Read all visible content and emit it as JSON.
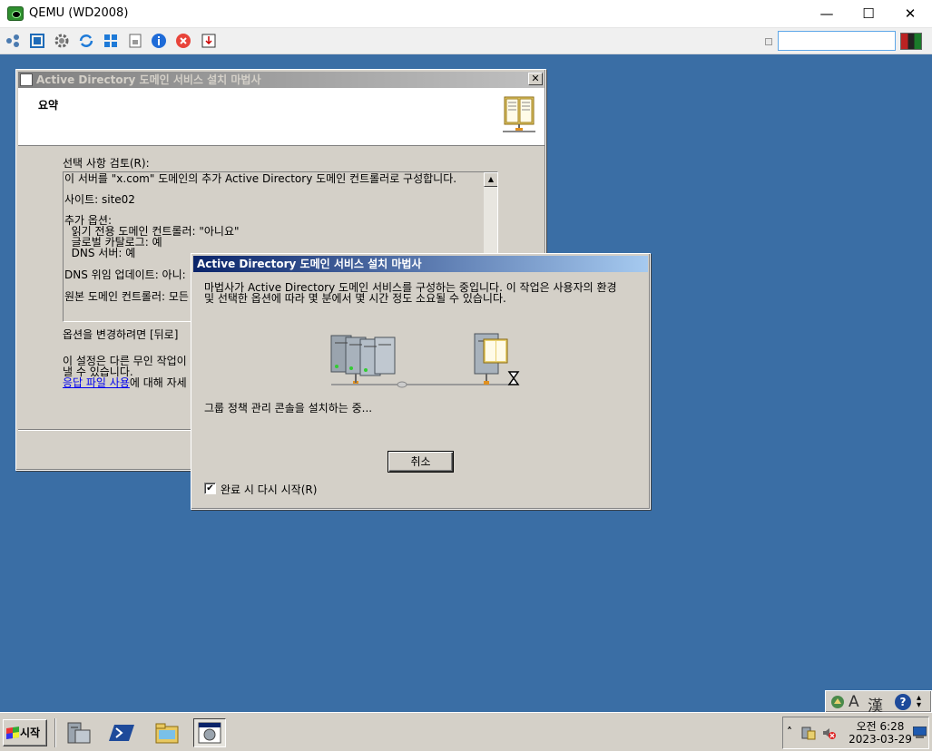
{
  "host": {
    "title": "QEMU (WD2008)",
    "minimize": "—",
    "maximize": "☐",
    "close": "✕",
    "toolbar_icons": [
      "network-icon",
      "fullscreen-icon",
      "settings-icon",
      "refresh-icon",
      "windows-logo-icon",
      "document-icon",
      "info-icon",
      "stop-icon",
      "exit-icon"
    ]
  },
  "bg_wizard": {
    "title": "Active Directory 도메인 서비스 설치 마법사",
    "header": "요약",
    "review_label": "선택 사항 검토(R):",
    "summary_lines": [
      "이 서버를 \"x.com\" 도메인의 추가 Active Directory 도메인 컨트롤러로 구성합니다.",
      "",
      "사이트: site02",
      "",
      "추가 옵션:",
      "  읽기 전용 도메인 컨트롤러: \"아니요\"",
      "  글로벌 카탈로그: 예",
      "  DNS 서버: 예",
      "",
      "DNS 위임 업데이트: 아니:",
      "",
      "원본 도메인 컨트롤러: 모든"
    ],
    "change_text": "옵션을 변경하려면 [뒤로]",
    "settings_line1": "이 설정은 다른 무인 작업이",
    "settings_line2": "낼 수 있습니다.",
    "answer_link": "응답 파일 사용",
    "answer_rest": "에 대해 자세"
  },
  "progress_dialog": {
    "title": "Active Directory 도메인 서비스 설치 마법사",
    "message_line1": "마법사가 Active Directory 도메인 서비스를 구성하는 중입니다. 이 작업은 사용자의 환경",
    "message_line2": "및 선택한 옵션에 따라 몇 분에서 몇 시간 정도 소요될 수 있습니다.",
    "status": "그룹 정책 관리 콘솔을 설치하는 중...",
    "cancel_label": "취소",
    "restart_label": "완료 시 다시 시작(R)",
    "restart_checked": "✔"
  },
  "langbar": {
    "icons": [
      "language-icon",
      "ime-mode-icon",
      "hanja-icon",
      "help-icon"
    ],
    "mode_label": "A",
    "hanja_label": "漢",
    "help_label": "?"
  },
  "taskbar": {
    "start_label": "시작",
    "apps": [
      "server-manager-icon",
      "powershell-icon",
      "explorer-icon",
      "wizard-task-icon"
    ],
    "clock_time": "오전 6:28",
    "clock_date": "2023-03-29"
  }
}
